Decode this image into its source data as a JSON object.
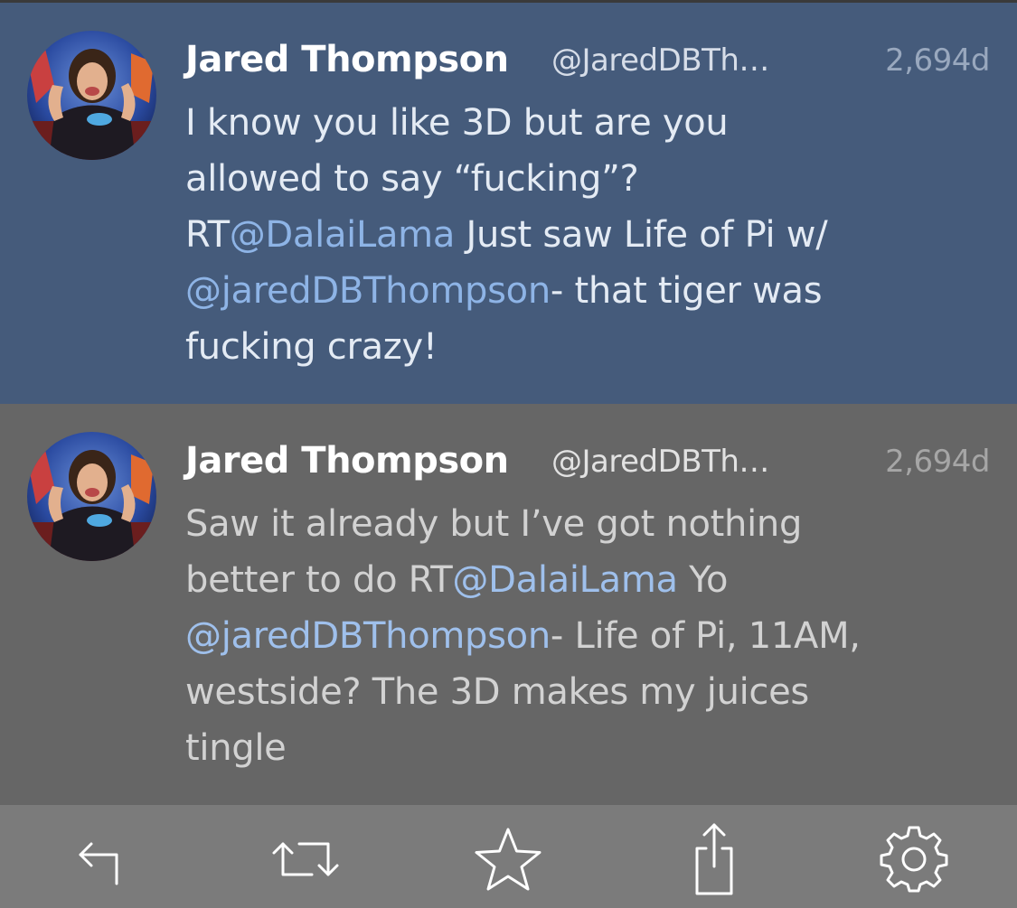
{
  "colors": {
    "selected_tweet_bg": "#455b7b",
    "tweet_bg": "#666666",
    "toolbar_bg": "#7b7b7b",
    "mention": "#8eb4e6"
  },
  "tweets": [
    {
      "name": "Jared Thompson",
      "handle": "@JaredDBTh…",
      "time": "2,694d",
      "avatar_icon": "avatar-photo",
      "lines": [
        [
          {
            "t": "I know you like 3D but are you"
          }
        ],
        [
          {
            "t": "allowed to say “fucking”?"
          }
        ],
        [
          {
            "t": "RT"
          },
          {
            "t": "@DalaiLama",
            "m": true
          },
          {
            "t": " Just saw Life of Pi w/"
          }
        ],
        [
          {
            "t": "@jaredDBThompson",
            "m": true
          },
          {
            "t": "- that tiger was"
          }
        ],
        [
          {
            "t": "fucking crazy!"
          }
        ]
      ]
    },
    {
      "name": "Jared Thompson",
      "handle": "@JaredDBTh…",
      "time": "2,694d",
      "avatar_icon": "avatar-photo",
      "lines": [
        [
          {
            "t": "Saw it already but I’ve got nothing"
          }
        ],
        [
          {
            "t": "better to do RT"
          },
          {
            "t": "@DalaiLama",
            "m": true
          },
          {
            "t": " Yo"
          }
        ],
        [
          {
            "t": "@jaredDBThompson",
            "m": true
          },
          {
            "t": "- Life of Pi, 11AM,"
          }
        ],
        [
          {
            "t": "westside? The 3D makes my juices"
          }
        ],
        [
          {
            "t": "tingle"
          }
        ]
      ]
    }
  ],
  "toolbar": {
    "icons": [
      "reply-icon",
      "retweet-icon",
      "star-icon",
      "share-icon",
      "gear-icon"
    ]
  }
}
